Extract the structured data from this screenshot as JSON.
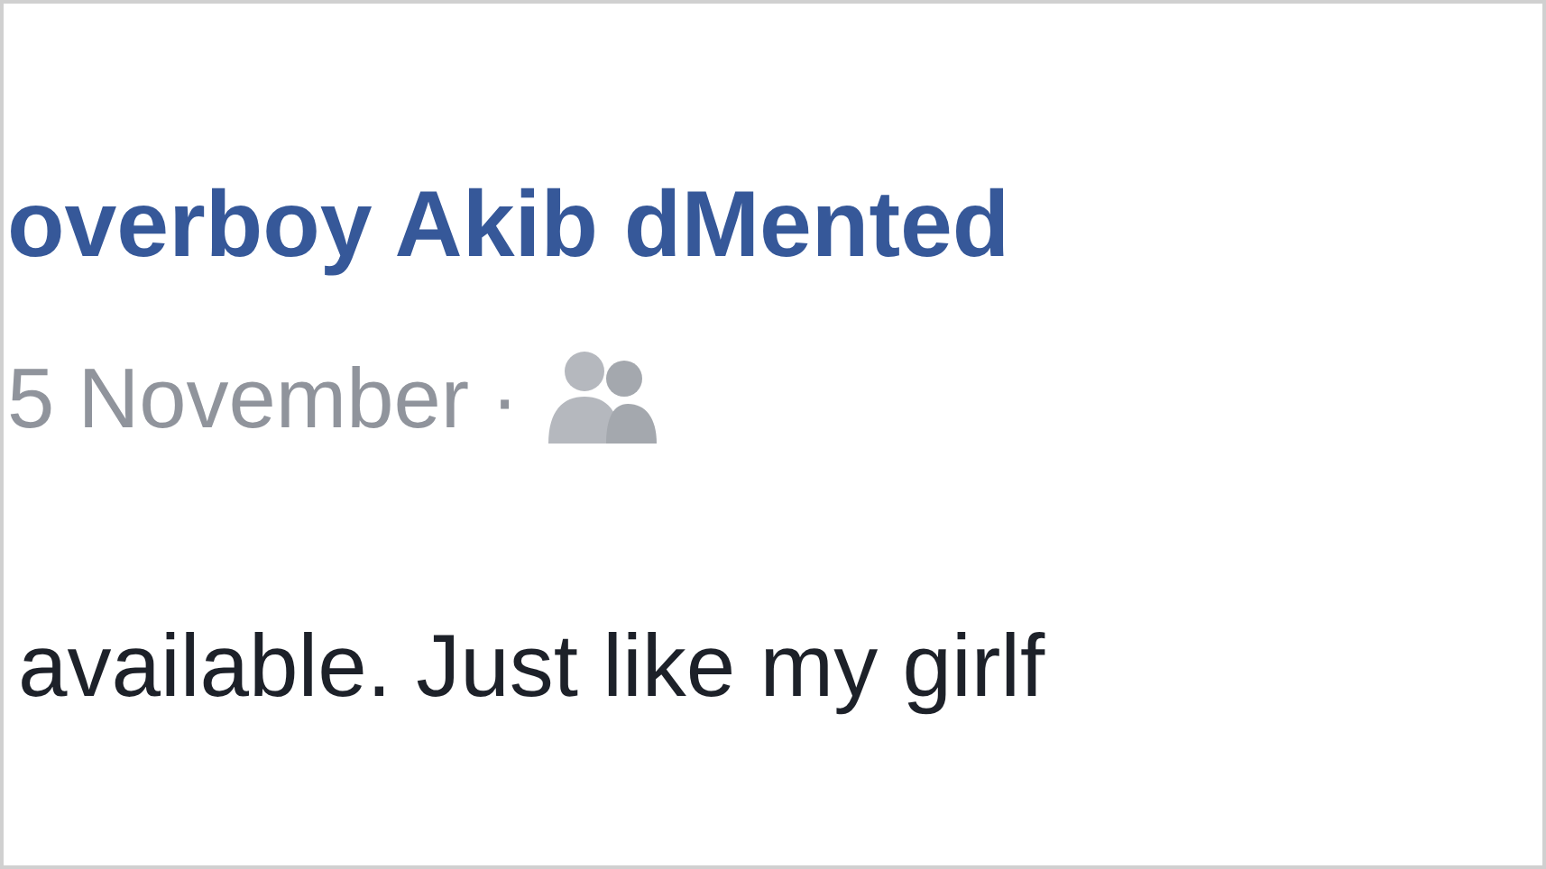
{
  "post": {
    "author": "overboy Akib dMented",
    "date": "5 November",
    "separator": "·",
    "text": "available. Just like my girlf"
  }
}
